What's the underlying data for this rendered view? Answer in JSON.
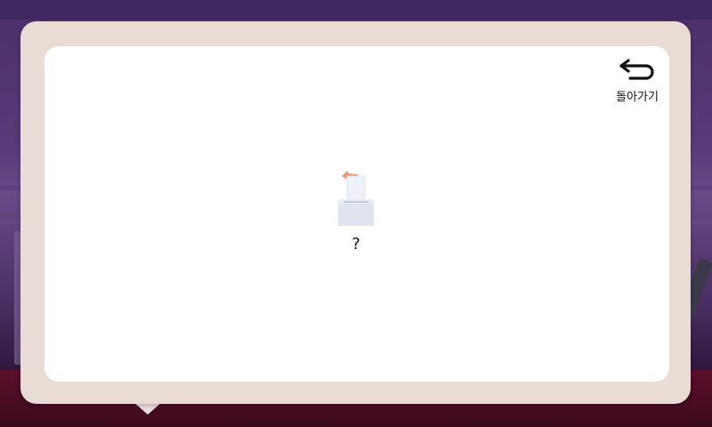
{
  "modal": {
    "back_label": "돌아가기",
    "message": "?"
  },
  "icons": {
    "back": "return-arrow-icon",
    "ballot": "ballot-box-icon"
  },
  "colors": {
    "frame": "#e8dcd4",
    "panel": "#ffffff",
    "ballot_box": "#dfe4ef",
    "ballot_hand": "#e59a74"
  }
}
